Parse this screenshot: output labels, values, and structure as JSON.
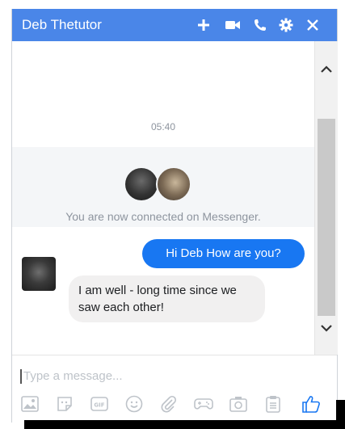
{
  "header": {
    "title": "Deb Thetutor",
    "icons": [
      "plus-icon",
      "video-icon",
      "phone-icon",
      "gear-icon",
      "close-icon"
    ]
  },
  "conversation": {
    "timestamp": "05:40",
    "connected_text": "You are now connected on Messenger.",
    "messages": [
      {
        "direction": "out",
        "text": "Hi Deb How are you?"
      },
      {
        "direction": "in",
        "text": "I am well - long time since we saw each other!"
      }
    ]
  },
  "composer": {
    "placeholder": "Type a message...",
    "tools": [
      "photo-icon",
      "sticker-icon",
      "gif-icon",
      "emoji-icon",
      "attachment-icon",
      "game-icon",
      "camera-icon",
      "notes-icon",
      "like-icon"
    ]
  },
  "colors": {
    "header": "#4a86e8",
    "outgoing_bubble": "#1877f2",
    "incoming_bubble": "#f1f0f0"
  }
}
